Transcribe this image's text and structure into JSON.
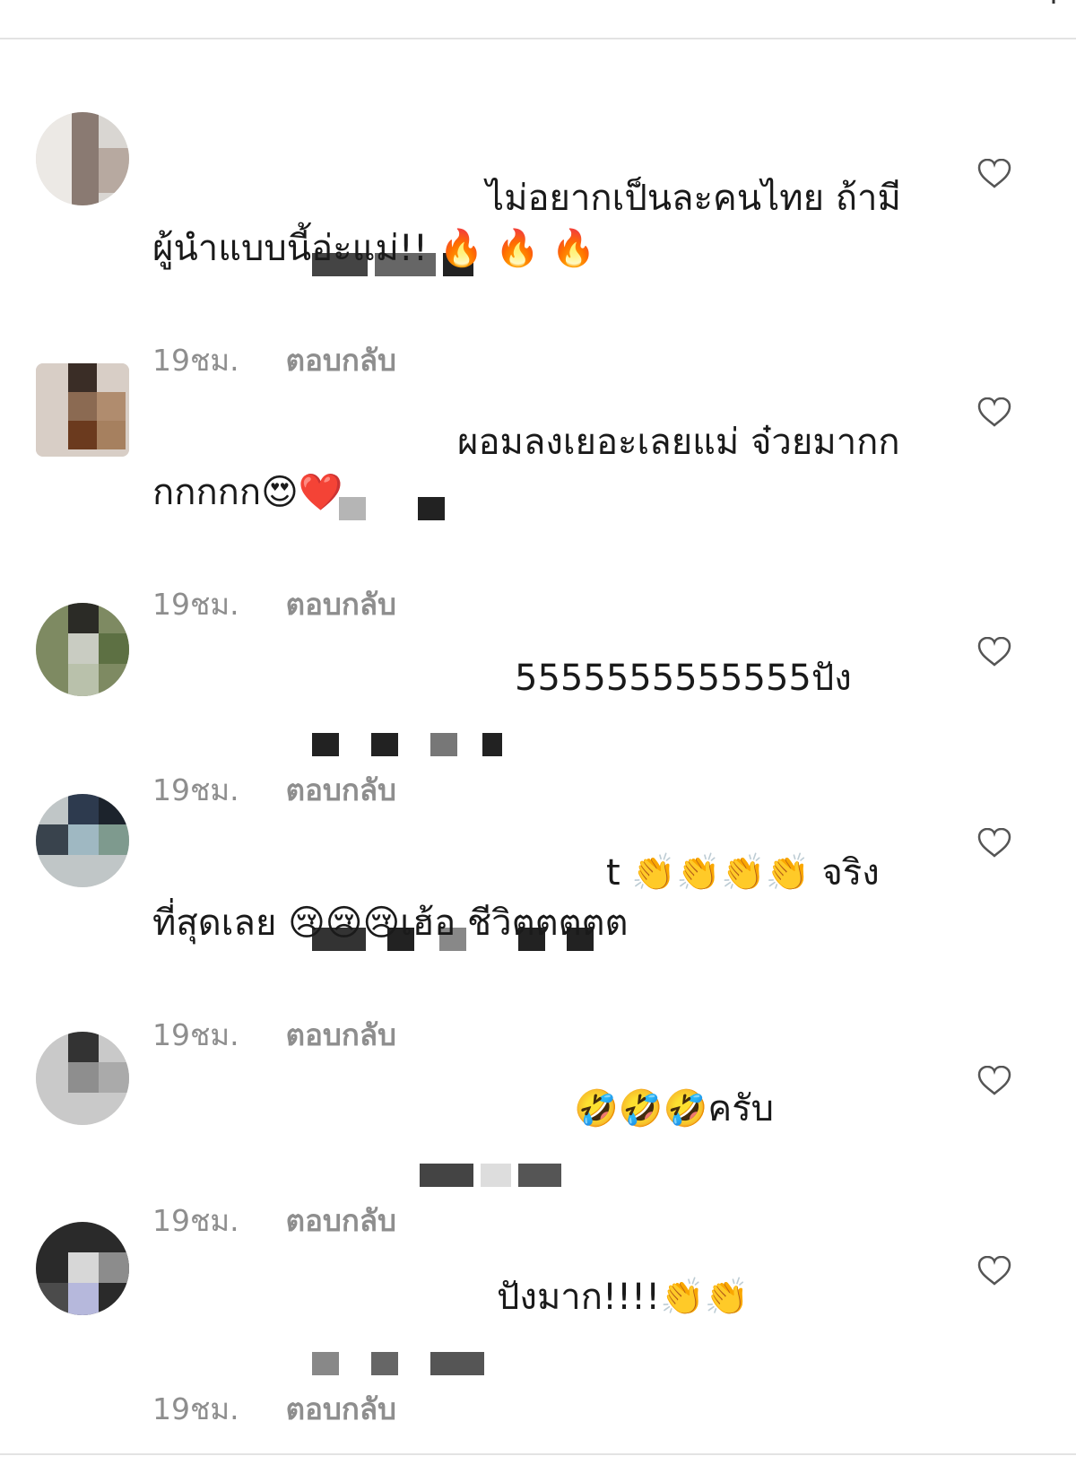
{
  "comments": [
    {
      "username_masked": true,
      "text": "ไม่อยากเป็นละคนไทย ถ้ามีผู้นำแบบนี้อ่ะแม่!! 🔥 🔥 🔥",
      "time": "19ชม.",
      "reply_label": "ตอบกลับ"
    },
    {
      "username_masked": true,
      "text": "ผอมลงเยอะเลยแม่ จ๋วยมากกกกกกก😍❤️",
      "time": "19ชม.",
      "reply_label": "ตอบกลับ"
    },
    {
      "username_masked": true,
      "text": "5555555555555ปัง",
      "time": "19ชม.",
      "reply_label": "ตอบกลับ"
    },
    {
      "username_masked": true,
      "text": "t 👏👏👏👏 จริงที่สุดเลย 😢😢😢เฮ้อ ชีวิตตตตต",
      "time": "19ชม.",
      "reply_label": "ตอบกลับ"
    },
    {
      "username_masked": true,
      "text": "🤣🤣🤣ครับ",
      "time": "19ชม.",
      "reply_label": "ตอบกลับ"
    },
    {
      "username_masked": true,
      "text": "ปังมาก!!!!👏👏",
      "time": "19ชม.",
      "reply_label": "ตอบกลับ"
    }
  ],
  "icons": {
    "like": "heart-outline-icon",
    "top": "chevron-icon"
  },
  "colors": {
    "text": "#1a1a1a",
    "meta": "#8e8e8e",
    "heart": "#555555",
    "divider": "#e3e3e3"
  }
}
